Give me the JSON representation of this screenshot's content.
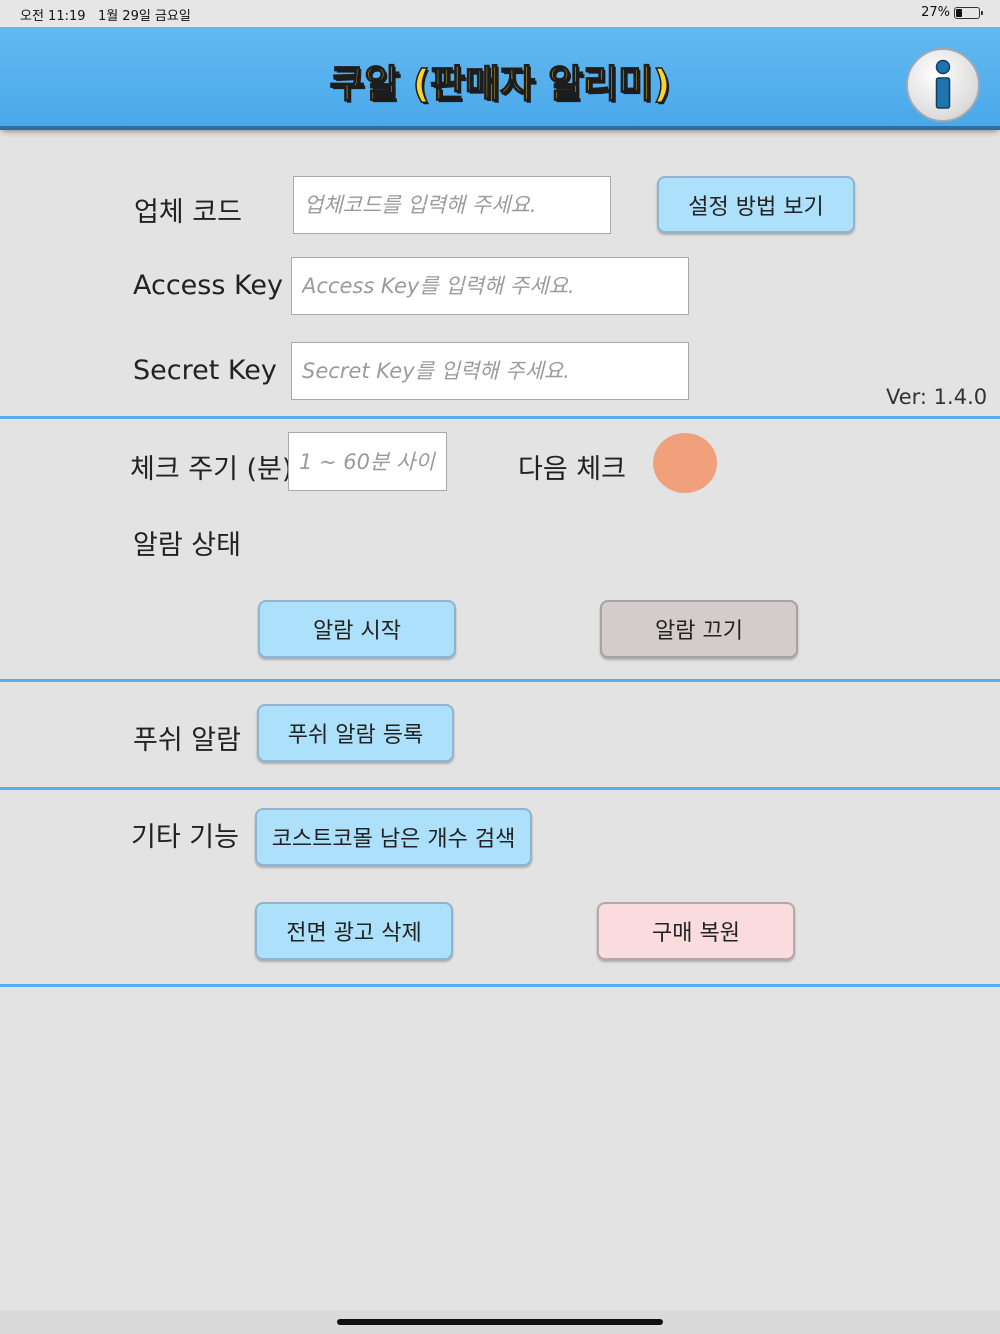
{
  "status_bar": {
    "time": "오전 11:19",
    "date": "1월 29일 금요일",
    "battery_percent": "27%",
    "battery_level": 0.27
  },
  "header": {
    "title": "쿠알 (판매자 알리미)",
    "title_color": "#ffd427",
    "background_color": "#4aa8ea",
    "info_icon": "info-icon"
  },
  "settings": {
    "company_code": {
      "label": "업체 코드",
      "placeholder": "업체코드를 입력해 주세요.",
      "value": ""
    },
    "how_to_button": "설정 방법 보기",
    "access_key": {
      "label": "Access Key",
      "placeholder": "Access Key를 입력해 주세요.",
      "value": ""
    },
    "secret_key": {
      "label": "Secret Key",
      "placeholder": "Secret Key를 입력해 주세요.",
      "value": ""
    },
    "version": "Ver: 1.4.0"
  },
  "check": {
    "interval_label": "체크 주기 (분)",
    "interval_placeholder": "1 ~ 60분 사이",
    "interval_value": "",
    "next_check_label": "다음 체크",
    "next_check_color": "#f0a07a",
    "alarm_status_label": "알람 상태",
    "alarm_start_button": "알람 시작",
    "alarm_stop_button": "알람 끄기"
  },
  "push": {
    "label": "푸쉬 알람",
    "register_button": "푸쉬 알람 등록"
  },
  "etc": {
    "label": "기타 기능",
    "costco_button": "코스트코몰 남은 개수 검색",
    "remove_ads_button": "전면 광고 삭제",
    "restore_button": "구매 복원"
  },
  "colors": {
    "primary_button": "#ade0fb",
    "disabled_button": "#d4cccc",
    "restore_button": "#fadcdf",
    "divider": "#59adea"
  }
}
